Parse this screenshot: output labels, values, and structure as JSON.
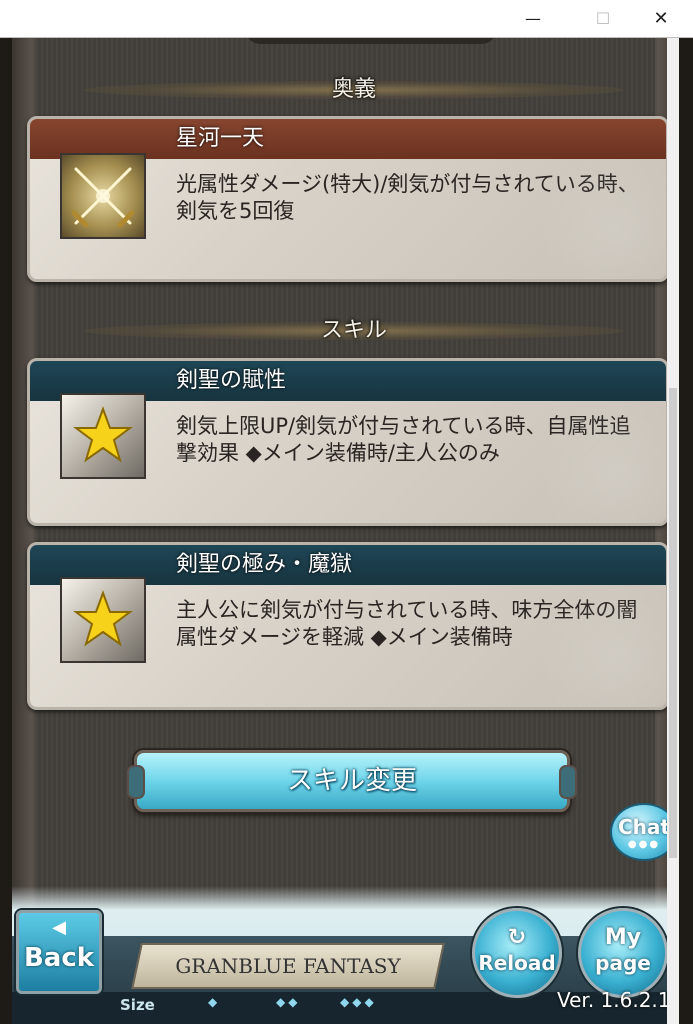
{
  "window": {
    "minimize_glyph": "—",
    "maximize_glyph": "☐",
    "close_glyph": "✕"
  },
  "ougi": {
    "section_label": "奥義",
    "name": "星河一天",
    "description": "光属性ダメージ(特大)/剣気が付与されている時、剣気を5回復",
    "icon": "crossed-swords-icon"
  },
  "skills": {
    "section_label": "スキル",
    "items": [
      {
        "name": "剣聖の賦性",
        "description": "剣気上限UP/剣気が付与されている時、自属性追撃効果 ◆メイン装備時/主人公のみ",
        "icon": "star-icon"
      },
      {
        "name": "剣聖の極み・魔獄",
        "description": "主人公に剣気が付与されている時、味方全体の闇属性ダメージを軽減 ◆メイン装備時",
        "icon": "star-icon"
      }
    ]
  },
  "buttons": {
    "skill_change": "スキル変更",
    "chat": "Chat",
    "back": "Back",
    "reload": "Reload",
    "mypage_line1": "My",
    "mypage_line2": "page"
  },
  "footer": {
    "logo_text": "GRANBLUE FANTASY",
    "size_label": "Size",
    "size_options": [
      "◆",
      "◆◆",
      "◆◆◆"
    ],
    "version": "Ver. 1.6.2.1"
  }
}
